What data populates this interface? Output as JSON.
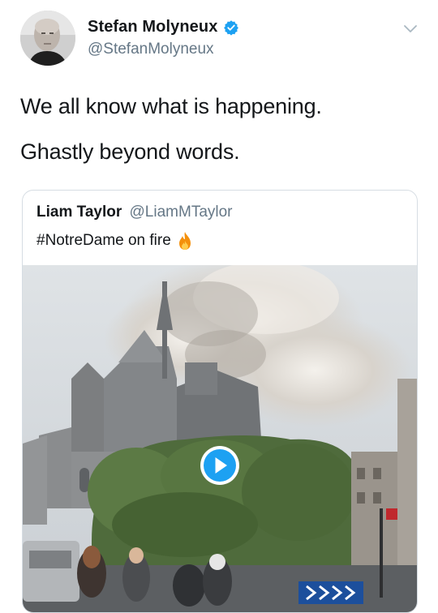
{
  "author": {
    "display_name": "Stefan Molyneux",
    "handle": "@StefanMolyneux",
    "verified": true,
    "avatar_icon": "profile-photo"
  },
  "tweet": {
    "lines": [
      "We all know what is happening.",
      "Ghastly beyond words."
    ]
  },
  "quoted_tweet": {
    "display_name": "Liam Taylor",
    "handle": "@LiamMTaylor",
    "text": "#NotreDame on fire",
    "emoji_icon": "fire-icon",
    "media": {
      "type": "video",
      "play_icon": "play-icon"
    }
  },
  "colors": {
    "accent": "#1da1f2",
    "secondary_text": "#657786",
    "primary_text": "#14171a",
    "border": "#d6dde3"
  }
}
